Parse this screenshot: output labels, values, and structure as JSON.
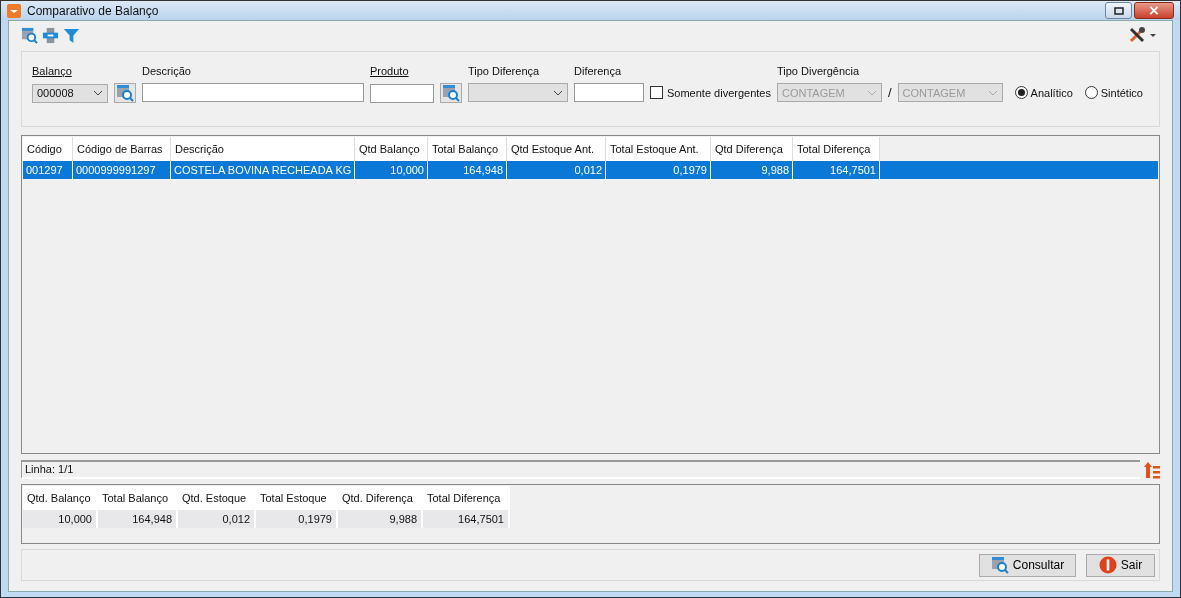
{
  "window": {
    "title": "Comparativo de Balanço"
  },
  "filters": {
    "balanco": {
      "label": "Balanço",
      "value": "000008"
    },
    "descricao": {
      "label": "Descrição"
    },
    "produto": {
      "label": "Produto"
    },
    "tipo_diferenca": {
      "label": "Tipo Diferença"
    },
    "diferenca": {
      "label": "Diferença"
    },
    "somente_divergentes": {
      "label": "Somente divergentes",
      "checked": false
    },
    "tipo_divergencia": {
      "label": "Tipo Divergência",
      "from": "CONTAGEM",
      "separator": "/",
      "to": "CONTAGEM"
    },
    "modes": [
      {
        "label": "Analítico",
        "selected": true
      },
      {
        "label": "Sintético",
        "selected": false
      }
    ]
  },
  "table": {
    "columns": [
      "Código",
      "Código de Barras",
      "Descrição",
      "Qtd Balanço",
      "Total Balanço",
      "Qtd Estoque Ant.",
      "Total Estoque Ant.",
      "Qtd Diferença",
      "Total Diferença"
    ],
    "rows": [
      {
        "cells": [
          "001297",
          "0000999991297",
          "COSTELA BOVINA RECHEADA KG",
          "10,000",
          "164,948",
          "0,012",
          "0,1979",
          "9,988",
          "164,7501"
        ],
        "selected": true
      }
    ]
  },
  "status_bar": "Linha: 1/1",
  "totals": {
    "columns": [
      "Qtd. Balanço",
      "Total Balanço",
      "Qtd. Estoque",
      "Total Estoque",
      "Qtd. Diferença",
      "Total Diferença"
    ],
    "values": [
      "10,000",
      "164,948",
      "0,012",
      "0,1979",
      "9,988",
      "164,7501"
    ]
  },
  "buttons": [
    {
      "label": "Consultar",
      "kind": "search"
    },
    {
      "label": "Sair",
      "kind": "exit"
    }
  ]
}
